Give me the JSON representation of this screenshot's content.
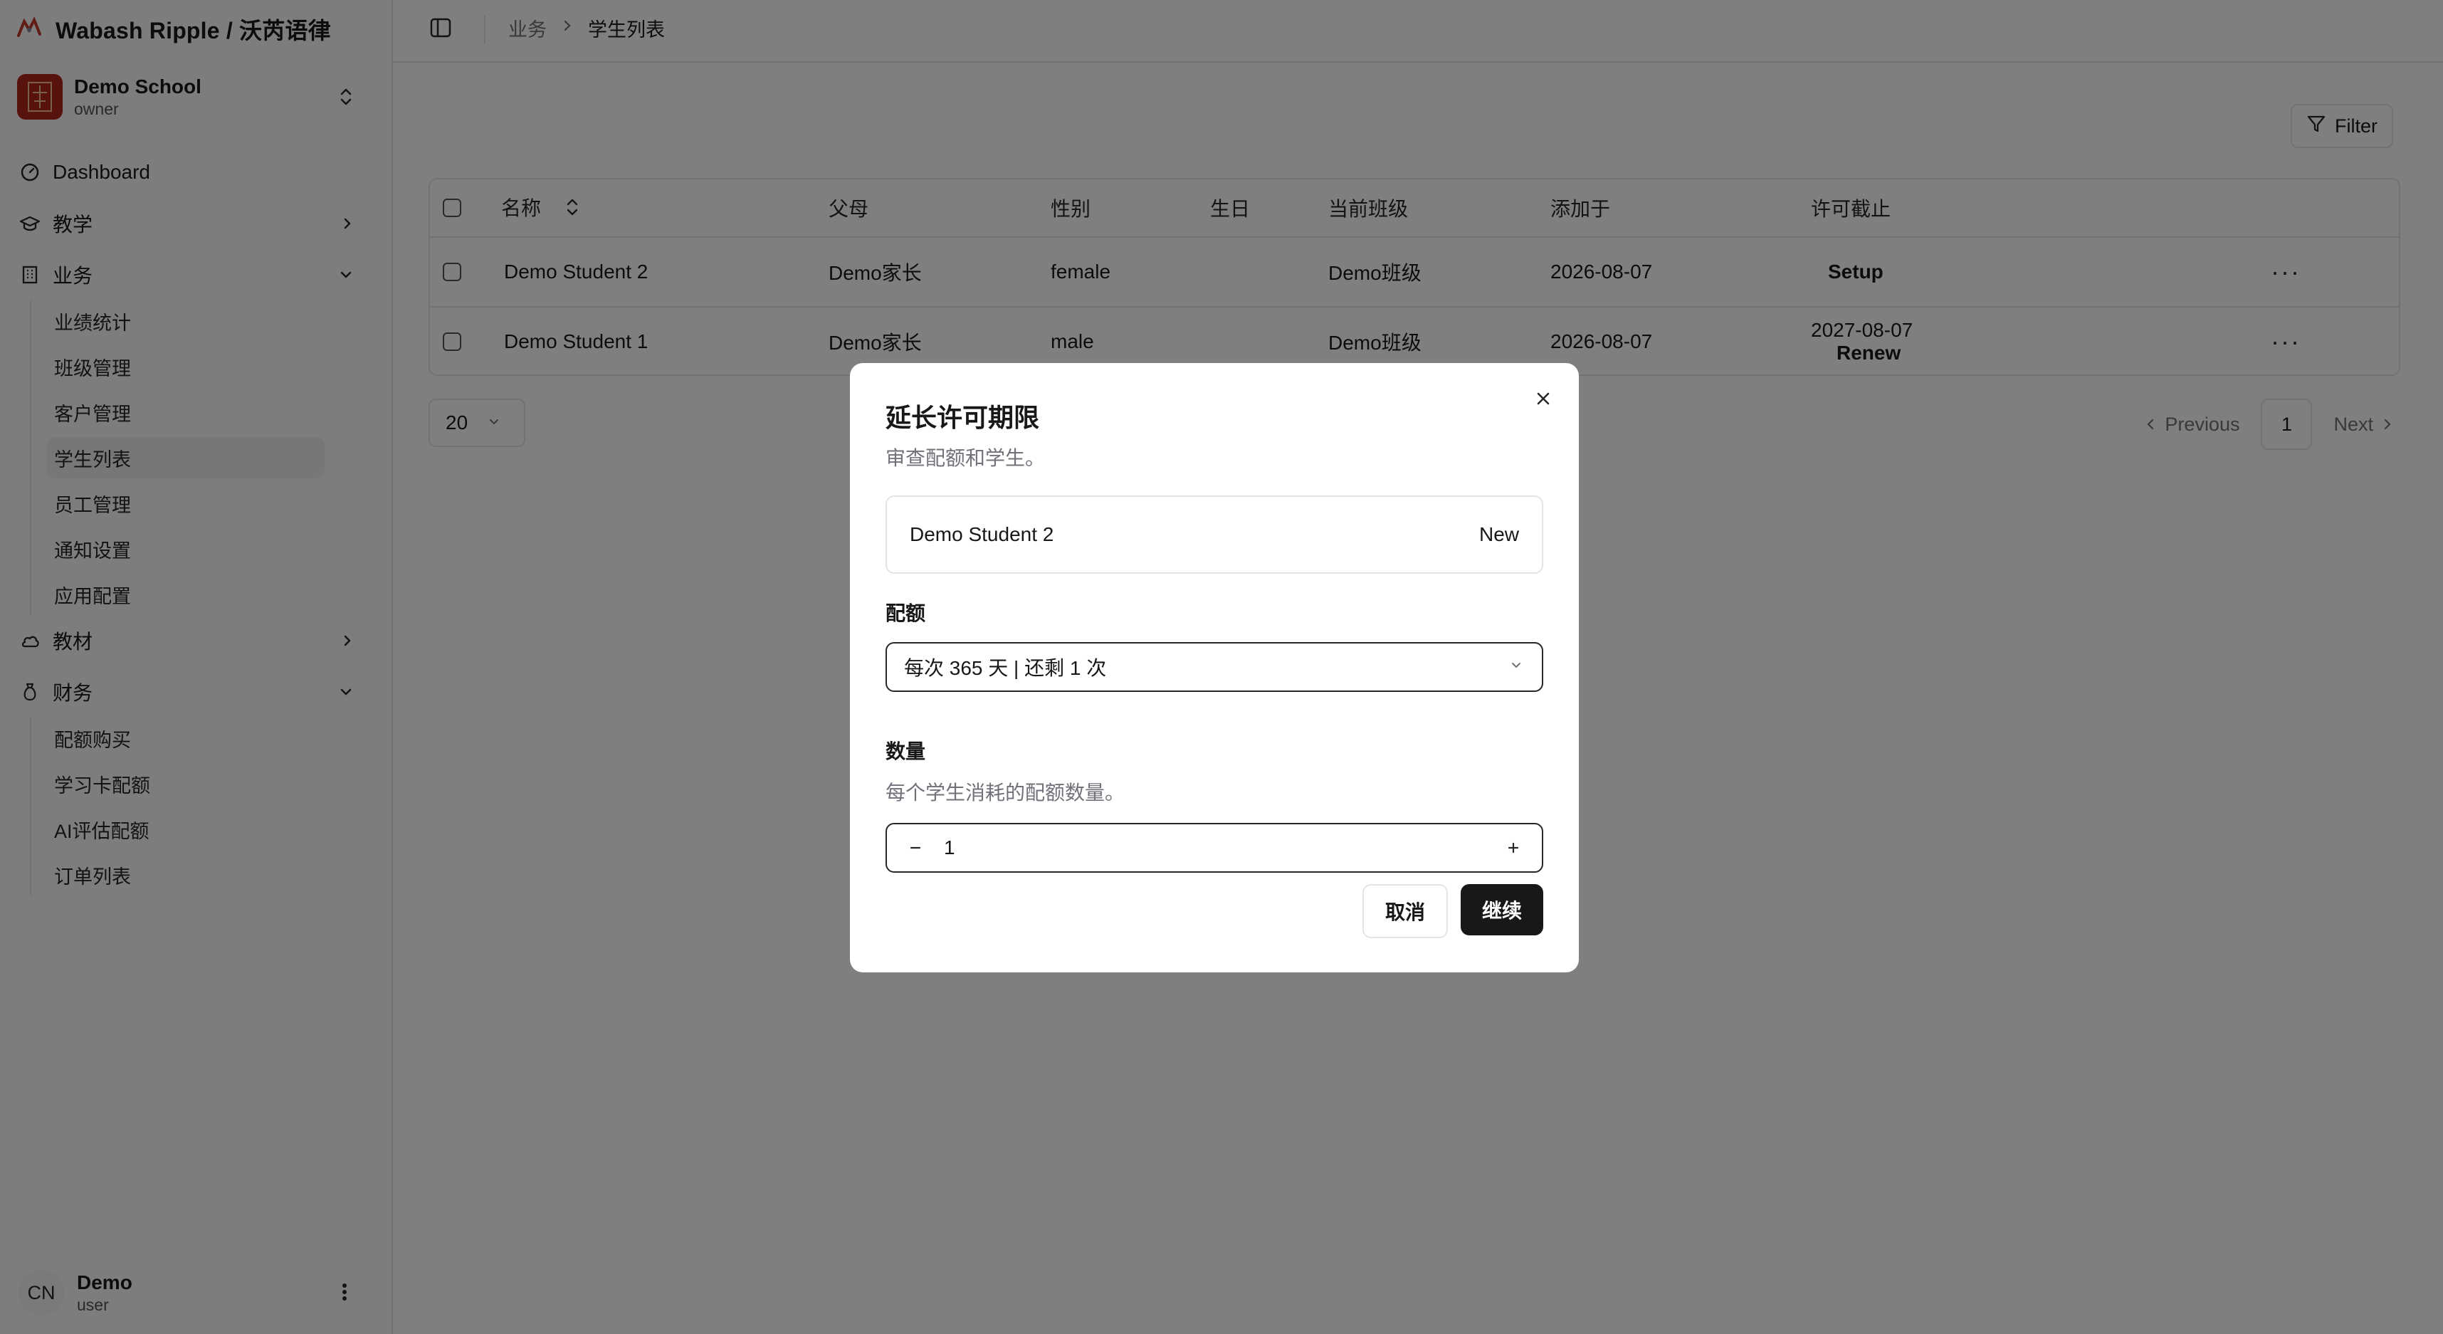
{
  "brand": {
    "title": "Wabash Ripple / 沃芮语律"
  },
  "school": {
    "name": "Demo School",
    "role": "owner"
  },
  "nav": {
    "dashboard": "Dashboard",
    "teaching": "教学",
    "business": "业务",
    "business_items": [
      "业绩统计",
      "班级管理",
      "客户管理",
      "学生列表",
      "员工管理",
      "通知设置",
      "应用配置"
    ],
    "materials": "教材",
    "finance": "财务",
    "finance_items": [
      "配额购买",
      "学习卡配额",
      "AI评估配额",
      "订单列表"
    ]
  },
  "user": {
    "initials": "CN",
    "name": "Demo",
    "role": "user"
  },
  "breadcrumb": {
    "parent": "业务",
    "current": "学生列表"
  },
  "toolbar": {
    "filter_label": "Filter"
  },
  "table": {
    "columns": [
      "名称",
      "父母",
      "性别",
      "生日",
      "当前班级",
      "添加于",
      "许可截止"
    ],
    "rows": [
      {
        "name": "Demo Student 2",
        "parent": "Demo家长",
        "gender": "female",
        "birthday": "",
        "class": "Demo班级",
        "added": "2026-08-07",
        "license": "",
        "action": "Setup"
      },
      {
        "name": "Demo Student 1",
        "parent": "Demo家长",
        "gender": "male",
        "birthday": "",
        "class": "Demo班级",
        "added": "2026-08-07",
        "license": "2027-08-07",
        "action": "Renew"
      }
    ]
  },
  "pagination": {
    "page_size": "20",
    "previous": "Previous",
    "current_page": "1",
    "next": "Next"
  },
  "modal": {
    "title": "延长许可期限",
    "description": "审查配额和学生。",
    "student_name": "Demo Student 2",
    "student_status": "New",
    "quota_label": "配额",
    "quota_value": "每次 365 天 | 还剩 1 次",
    "quantity_label": "数量",
    "quantity_hint": "每个学生消耗的配额数量。",
    "quantity_value": "1",
    "cancel_label": "取消",
    "continue_label": "继续"
  },
  "colors": {
    "overlay": "#00000080",
    "primary_button": "#18181b",
    "school_logo": "#b3261e"
  }
}
